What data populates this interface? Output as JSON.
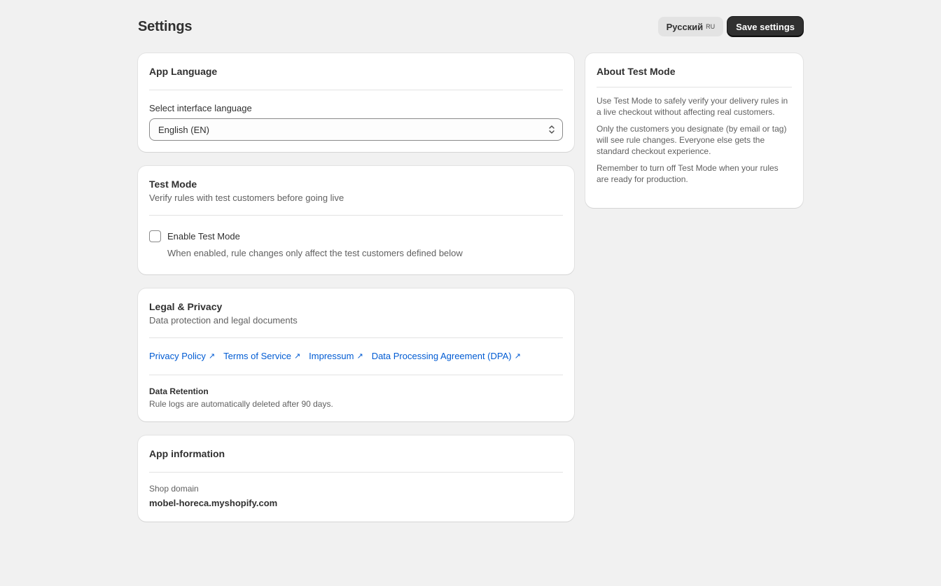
{
  "header": {
    "title": "Settings",
    "lang_button_label": "Русский",
    "lang_button_code": "RU",
    "save_label": "Save settings"
  },
  "app_language": {
    "title": "App Language",
    "select_label": "Select interface language",
    "selected_value": "English (EN)"
  },
  "test_mode": {
    "title": "Test Mode",
    "subtitle": "Verify rules with test customers before going live",
    "checkbox_label": "Enable Test Mode",
    "checked": false,
    "helper": "When enabled, rule changes only affect the test customers defined below"
  },
  "legal": {
    "title": "Legal & Privacy",
    "subtitle": "Data protection and legal documents",
    "links": [
      {
        "label": "Privacy Policy",
        "icon": "external-link-icon"
      },
      {
        "label": "Terms of Service",
        "icon": "external-link-icon"
      },
      {
        "label": "Impressum",
        "icon": "external-link-icon"
      },
      {
        "label": "Data Processing Agreement (DPA)",
        "icon": "external-link-icon"
      }
    ],
    "retention_title": "Data Retention",
    "retention_text": "Rule logs are automatically deleted after 90 days."
  },
  "app_info": {
    "title": "App information",
    "shop_domain_label": "Shop domain",
    "shop_domain_value": "mobel-horeca.myshopify.com"
  },
  "about": {
    "title": "About Test Mode",
    "paragraphs": [
      "Use Test Mode to safely verify your delivery rules in a live checkout without affecting real customers.",
      "Only the customers you designate (by email or tag) will see rule changes. Everyone else gets the standard checkout experience.",
      "Remember to turn off Test Mode when your rules are ready for production."
    ]
  },
  "colors": {
    "background": "#f1f1f1",
    "primary_button": "#303030",
    "link": "#005bd3"
  }
}
